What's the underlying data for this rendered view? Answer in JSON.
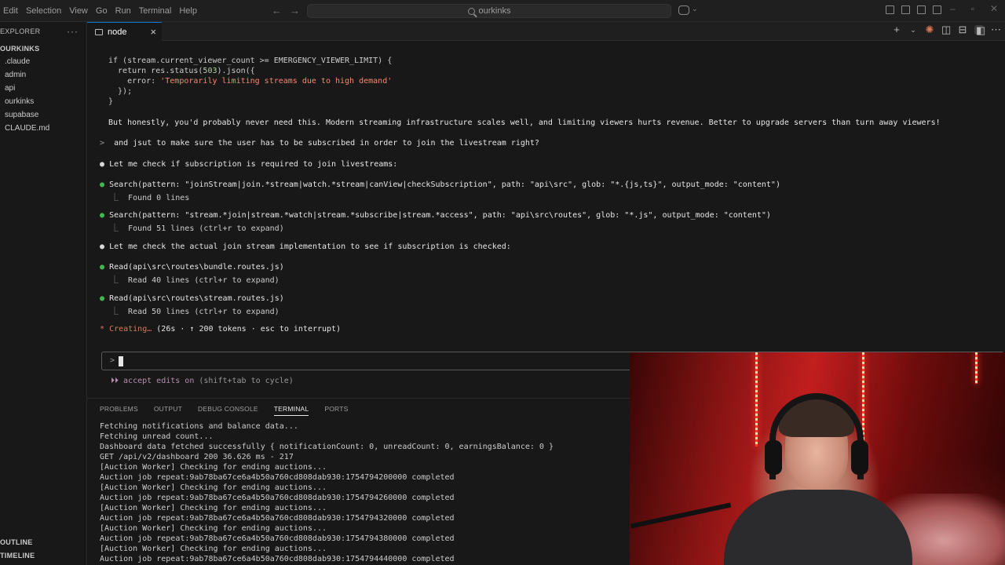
{
  "menu": [
    "Edit",
    "Selection",
    "View",
    "Go",
    "Run",
    "Terminal",
    "Help"
  ],
  "search_label": "ourkinks",
  "sidebar": {
    "header": "EXPLORER",
    "project": "OURKINKS",
    "items": [
      ".claude",
      "admin",
      "api",
      "ourkinks",
      "supabase",
      "CLAUDE.md"
    ],
    "outline": "OUTLINE",
    "timeline": "TIMELINE"
  },
  "tab": {
    "label": "node"
  },
  "code": {
    "l1_a": "if (stream.current_viewer_count >= EMERGENCY_VIEWER_LIMIT) {",
    "l2_a": "  return res.status(",
    "l2_num": "503",
    "l2_b": ").json({",
    "l3_a": "    error: ",
    "l3_str": "'Temporarily limiting streams due to high demand'",
    "l4": "  });",
    "l5": "}"
  },
  "conversation": {
    "honest": "But honestly, you'd probably never need this. Modern streaming infrastructure scales well, and limiting viewers hurts revenue. Better to upgrade servers than turn away viewers!",
    "user_prompt": "and jsut to make sure the user has to be subscribed in order to join the livestream right?",
    "check1": "Let me check if subscription is required to join livestreams:",
    "search1": "Search(pattern: \"joinStream|join.*stream|watch.*stream|canView|checkSubscription\", path: \"api\\src\", glob: \"*.{js,ts}\", output_mode: \"content\")",
    "search1_result": "Found 0 lines",
    "search2": "Search(pattern: \"stream.*join|stream.*watch|stream.*subscribe|stream.*access\", path: \"api\\src\\routes\", glob: \"*.js\", output_mode: \"content\")",
    "search2_result": "Found 51 lines (ctrl+r to expand)",
    "check2": "Let me check the actual join stream implementation to see if subscription is checked:",
    "read1": "Read(api\\src\\routes\\bundle.routes.js)",
    "read1_result": "Read 40 lines (ctrl+r to expand)",
    "read2": "Read(api\\src\\routes\\stream.routes.js)",
    "read2_result": "Read 50 lines (ctrl+r to expand)",
    "status_word": "Creating…",
    "status_detail": "(26s · ↑ 200 tokens · esc to interrupt)",
    "accept": "accept edits on",
    "accept_hint": "(shift+tab to cycle)"
  },
  "panel": {
    "tabs": [
      "PROBLEMS",
      "OUTPUT",
      "DEBUG CONSOLE",
      "TERMINAL",
      "PORTS"
    ],
    "lines": [
      "Fetching notifications and balance data...",
      "Fetching unread count...",
      "Dashboard data fetched successfully { notificationCount: 0, unreadCount: 0, earningsBalance: 0 }",
      "GET /api/v2/dashboard 200 36.626 ms - 217",
      "[Auction Worker] Checking for ending auctions...",
      "Auction job repeat:9ab78ba67ce6a4b50a760cd808dab930:1754794200000 completed",
      "[Auction Worker] Checking for ending auctions...",
      "Auction job repeat:9ab78ba67ce6a4b50a760cd808dab930:1754794260000 completed",
      "[Auction Worker] Checking for ending auctions...",
      "Auction job repeat:9ab78ba67ce6a4b50a760cd808dab930:1754794320000 completed",
      "[Auction Worker] Checking for ending auctions...",
      "Auction job repeat:9ab78ba67ce6a4b50a760cd808dab930:1754794380000 completed",
      "[Auction Worker] Checking for ending auctions...",
      "Auction job repeat:9ab78ba67ce6a4b50a760cd808dab930:1754794440000 completed"
    ]
  },
  "colors": {
    "accent": "#0078d4",
    "claude": "#d97757",
    "success": "#3fb950"
  }
}
